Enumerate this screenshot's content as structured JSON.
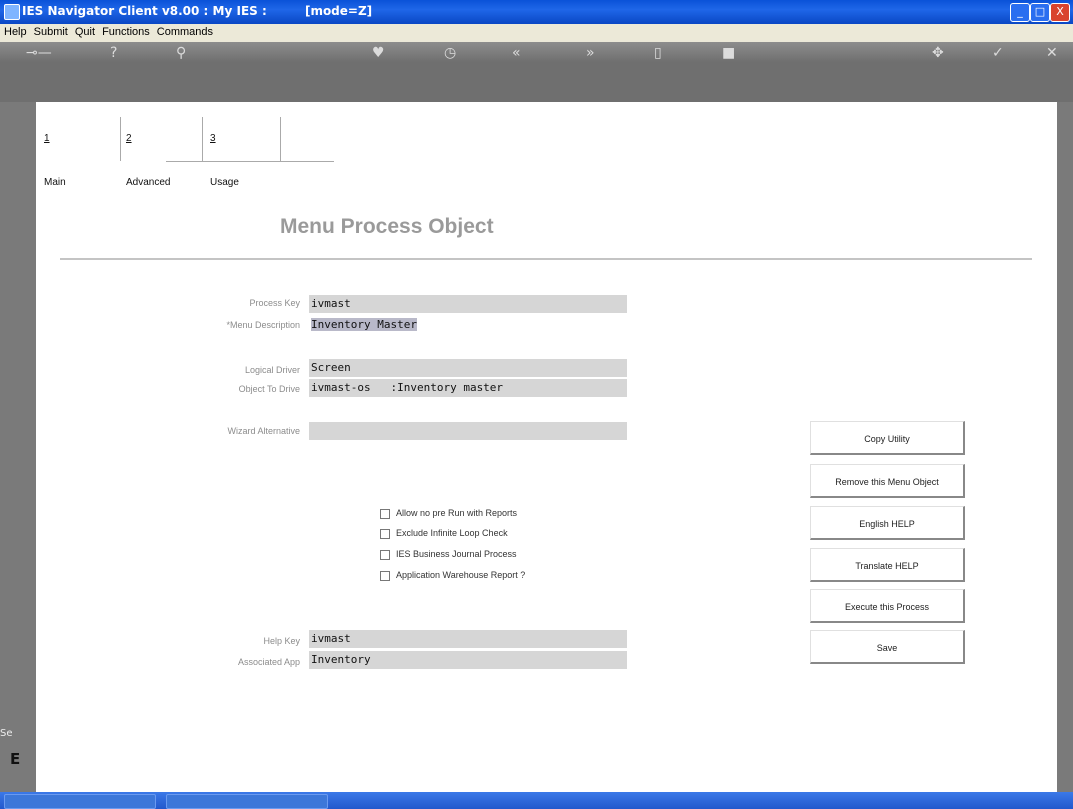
{
  "window": {
    "title": "IES Navigator Client v8.00 : My IES :",
    "mode": "[mode=Z]",
    "controls": [
      "_",
      "□",
      "X"
    ]
  },
  "menu": [
    "Help",
    "Submit",
    "Quit",
    "Functions",
    "Commands"
  ],
  "toolbar_icons": [
    "key-icon",
    "help-icon",
    "search-icon",
    "heart-icon",
    "clock-icon",
    "rewind-icon",
    "forward-icon",
    "copy-icon",
    "stop-icon",
    "move-icon",
    "check-icon",
    "close-icon"
  ],
  "tabs": [
    {
      "num": "1",
      "label": "Main"
    },
    {
      "num": "2",
      "label": "Advanced"
    },
    {
      "num": "3",
      "label": "Usage"
    }
  ],
  "heading": "Menu Process Object",
  "fields": {
    "process_key": {
      "label": "Process Key",
      "value": "ivmast"
    },
    "menu_description": {
      "label": "*Menu Description",
      "value": "Inventory Master"
    },
    "logical_driver": {
      "label": "Logical Driver",
      "value": "Screen"
    },
    "object_to_drive": {
      "label": "Object To Drive",
      "value": "ivmast-os   :Inventory master"
    },
    "wizard_alternative": {
      "label": "Wizard Alternative",
      "value": ""
    },
    "help_key": {
      "label": "Help Key",
      "value": "ivmast"
    },
    "associated_app": {
      "label": "Associated App",
      "value": "Inventory"
    }
  },
  "checkboxes": [
    {
      "label": "Allow no pre Run with Reports",
      "checked": false
    },
    {
      "label": "Exclude Infinite Loop Check",
      "checked": false
    },
    {
      "label": "IES Business Journal Process",
      "checked": false
    },
    {
      "label": "Application Warehouse Report ?",
      "checked": false
    }
  ],
  "buttons": [
    "Copy Utility",
    "Remove this Menu Object",
    "English HELP",
    "Translate HELP",
    "Execute this Process",
    "Save"
  ],
  "side": {
    "text": "Se",
    "glyph": "E"
  }
}
